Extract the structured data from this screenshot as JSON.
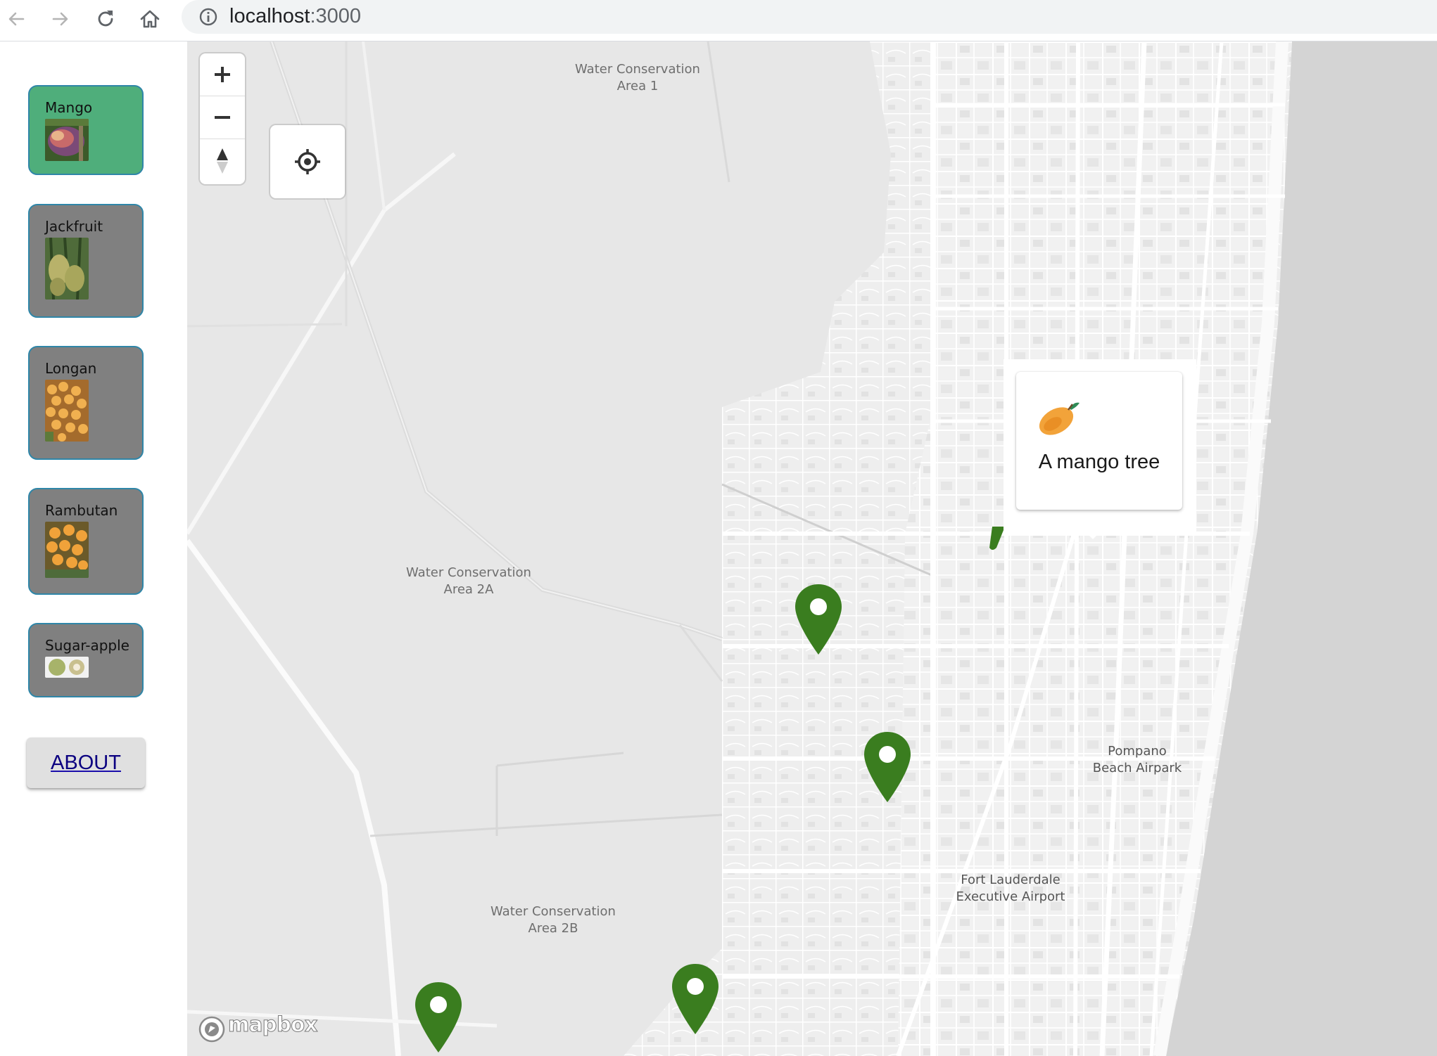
{
  "browser": {
    "url_host": "localhost",
    "url_port": ":3000"
  },
  "sidebar": {
    "items": [
      {
        "label": "Mango",
        "active": true,
        "thumb": "mango-photo"
      },
      {
        "label": "Jackfruit",
        "active": false,
        "thumb": "jackfruit-photo"
      },
      {
        "label": "Longan",
        "active": false,
        "thumb": "longan-photo"
      },
      {
        "label": "Rambutan",
        "active": false,
        "thumb": "rambutan-photo"
      },
      {
        "label": "Sugar-apple",
        "active": false,
        "thumb": "sugar-apple-photo"
      }
    ],
    "about_label": "ABOUT"
  },
  "map": {
    "labels": {
      "wca1": "Water Conservation\nArea 1",
      "wca2a": "Water Conservation\nArea 2A",
      "wca2b": "Water Conservation\nArea 2B",
      "pompano": "Pompano\nBeach Airpark",
      "fortlaud": "Fort Lauderdale\nExecutive Airport"
    },
    "controls": {
      "zoom_in": "plus-icon",
      "zoom_out": "minus-icon",
      "compass": "compass-icon",
      "geolocate": "crosshair-icon"
    },
    "popup": {
      "emoji": "mango-icon",
      "text": "A mango tree"
    },
    "attribution": "mapbox",
    "colors": {
      "marker": "#3a7d1f",
      "active_card": "#4fae7b",
      "inactive_card": "#808080",
      "card_border": "#2f86a8"
    }
  }
}
